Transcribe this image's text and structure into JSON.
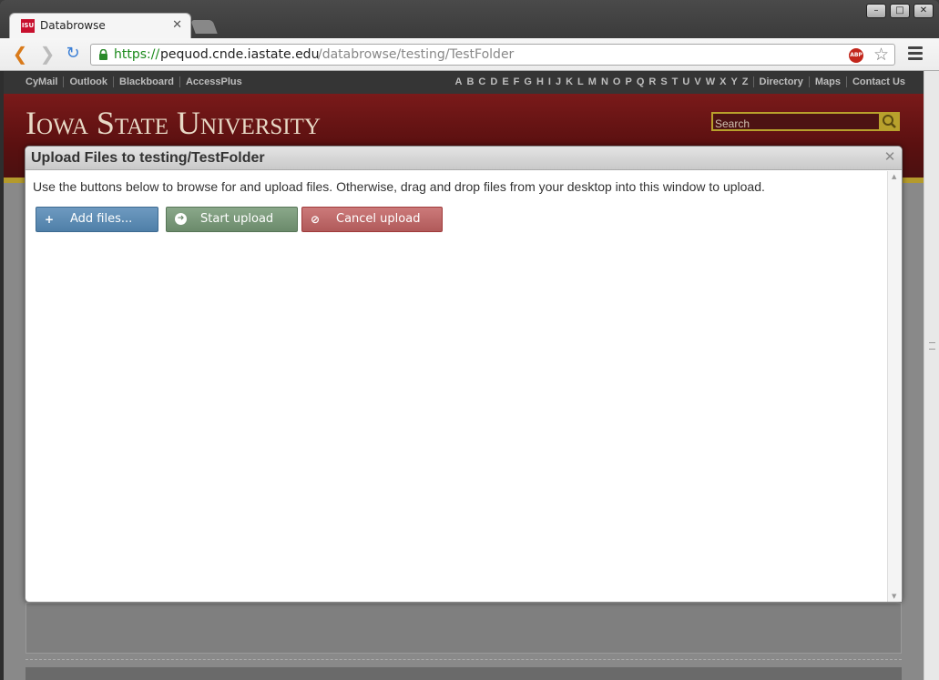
{
  "browser": {
    "tab_title": "Databrowse",
    "favicon_text": "ISU",
    "url_scheme": "https://",
    "url_host": "pequod.cnde.iastate.edu",
    "url_path": "/databrowse/testing/TestFolder",
    "abp_label": "ABP"
  },
  "isu": {
    "left_links": [
      "CyMail",
      "Outlook",
      "Blackboard",
      "AccessPlus"
    ],
    "letters": [
      "A",
      "B",
      "C",
      "D",
      "E",
      "F",
      "G",
      "H",
      "I",
      "J",
      "K",
      "L",
      "M",
      "N",
      "O",
      "P",
      "Q",
      "R",
      "S",
      "T",
      "U",
      "V",
      "W",
      "X",
      "Y",
      "Z"
    ],
    "right_links": [
      "Directory",
      "Maps",
      "Contact Us"
    ],
    "wordmark": "Iowa State University",
    "search_placeholder": "Search",
    "colors": {
      "cardinal": "#7a1a1a",
      "gold": "#b8a12c"
    }
  },
  "dialog": {
    "title": "Upload Files to testing/TestFolder",
    "message": "Use the buttons below to browse for and upload files. Otherwise, drag and drop files from your desktop into this window to upload.",
    "buttons": {
      "add": "Add files...",
      "start": "Start upload",
      "cancel": "Cancel upload"
    }
  }
}
